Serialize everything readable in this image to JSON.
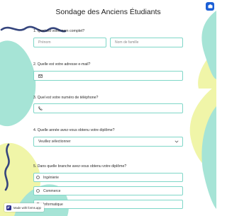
{
  "form": {
    "title": "Sondage des Anciens Étudiants"
  },
  "colors": {
    "accent": "#7fd7c8",
    "teal_blob": "#a6e4d6",
    "yellow_blob": "#f0f5a8",
    "navy_wave": "#35457d",
    "corner_button": "#1b5fd6"
  },
  "questions": {
    "q1": {
      "label": "1. Quel est votre nom complet?",
      "first_name_placeholder": "Prénom",
      "last_name_placeholder": "Nom de famille"
    },
    "q2": {
      "label": "2. Quelle est votre adresse e-mail?",
      "icon": "email-icon"
    },
    "q3": {
      "label": "3. Quel est votre numéro de téléphone?",
      "icon": "phone-icon"
    },
    "q4": {
      "label": "4. Quelle année avez-vous obtenu votre diplôme?",
      "selected": "Veuillez sélectionner"
    },
    "q5": {
      "label": "5. Dans quelle branche avez-vous obtenu votre diplôme?",
      "options": [
        "Ingénierie",
        "Commerce",
        "Informatique"
      ]
    }
  },
  "badge": {
    "label": "Made with forms.app"
  }
}
